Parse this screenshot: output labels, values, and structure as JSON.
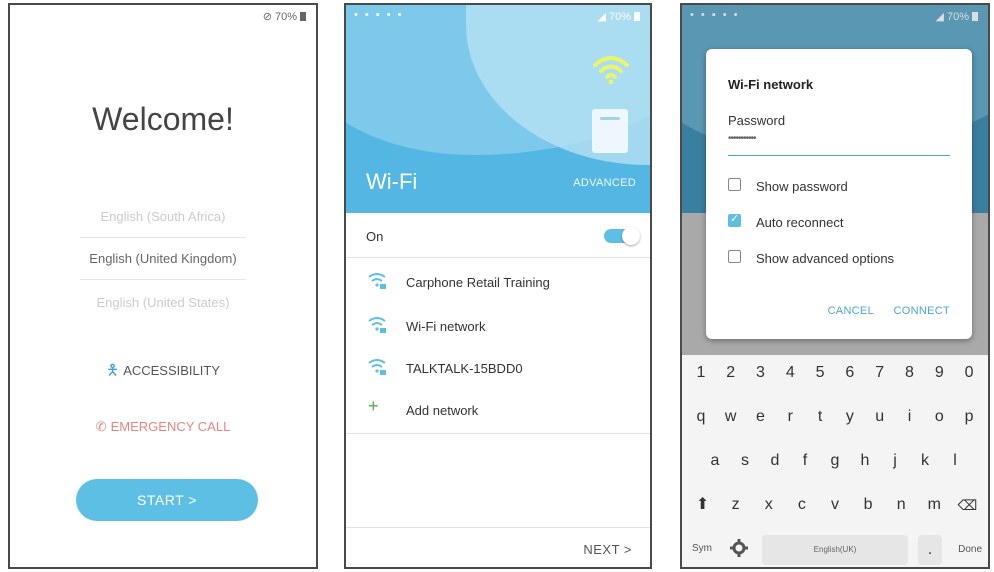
{
  "panel1": {
    "status": "70%",
    "title": "Welcome!",
    "languages": [
      "English (South Africa)",
      "English (United Kingdom)",
      "English (United States)"
    ],
    "accessibility": "ACCESSIBILITY",
    "emergency": "EMERGENCY CALL",
    "start": "START  >"
  },
  "panel2": {
    "status": "70%",
    "title": "Wi-Fi",
    "advanced": "ADVANCED",
    "on_label": "On",
    "networks": [
      "Carphone Retail Training",
      "Wi-Fi network",
      "TALKTALK-15BDD0"
    ],
    "add_network": "Add network",
    "next": "NEXT  >"
  },
  "panel3": {
    "status": "70%",
    "dialog": {
      "title": "Wi-Fi network",
      "password_label": "Password",
      "password_value": "•••••••••••",
      "show_password": "Show password",
      "auto_reconnect": "Auto reconnect",
      "show_advanced": "Show advanced options",
      "cancel": "CANCEL",
      "connect": "CONNECT"
    },
    "keyboard": {
      "row1": [
        "1",
        "2",
        "3",
        "4",
        "5",
        "6",
        "7",
        "8",
        "9",
        "0"
      ],
      "row2": [
        "q",
        "w",
        "e",
        "r",
        "t",
        "y",
        "u",
        "i",
        "o",
        "p"
      ],
      "row3": [
        "a",
        "s",
        "d",
        "f",
        "g",
        "h",
        "j",
        "k",
        "l"
      ],
      "row4": [
        "z",
        "x",
        "c",
        "v",
        "b",
        "n",
        "m"
      ],
      "sym": "Sym",
      "space": "English(UK)",
      "dot": ".",
      "done": "Done"
    }
  },
  "colors": {
    "accent": "#5ebfe5",
    "header_blue": "#54b7e3",
    "emergency": "#e8857e",
    "add_green": "#4caf50"
  },
  "icons": {
    "accessibility": "accessibility-icon",
    "emergency": "phone-icon",
    "wifi": "wifi-icon",
    "add": "plus-icon",
    "settings": "gear-icon",
    "shift": "shift-icon",
    "backspace": "backspace-icon"
  }
}
